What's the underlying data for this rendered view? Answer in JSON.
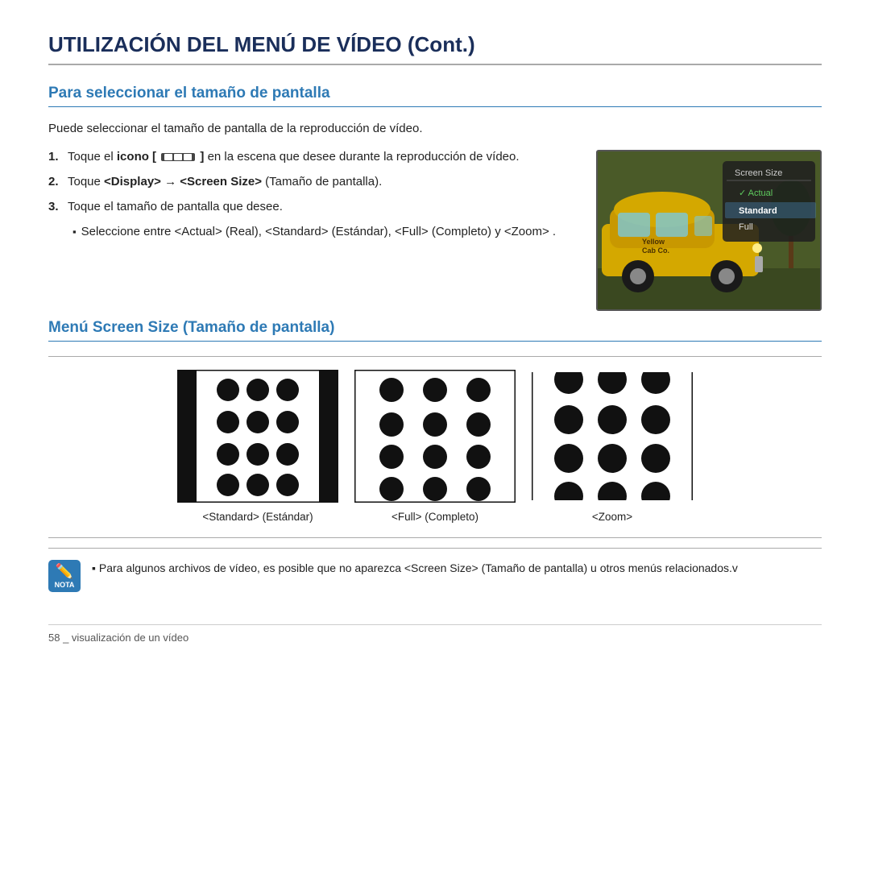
{
  "page": {
    "main_title": "UTILIZACIÓN DEL MENÚ DE VÍDEO (Cont.)",
    "section1_title": "Para seleccionar el tamaño de pantalla",
    "intro": "Puede seleccionar el tamaño de pantalla de la reproducción de vídeo.",
    "steps": [
      {
        "num": "1.",
        "text_before": "Toque el ",
        "bold": "icono [",
        "text_icon": "icon",
        "text_after": "] en la escena que desee durante la reproducción de vídeo."
      },
      {
        "num": "2.",
        "bold": "Toque <Display> → <Screen Size>",
        "text_after": " (Tamaño de pantalla)."
      },
      {
        "num": "3.",
        "text": "Toque el tamaño de pantalla que desee."
      }
    ],
    "bullet": "Seleccione entre <Actual> (Real), <Standard> (Estándar), <Full> (Completo) y <Zoom> .",
    "video_menu": {
      "title": "Screen Size",
      "items": [
        {
          "label": "Actual",
          "state": "checkmark"
        },
        {
          "label": "Standard",
          "state": "selected"
        },
        {
          "label": "Full",
          "state": "normal"
        }
      ]
    },
    "section2_title": "Menú Screen Size (Tamaño de pantalla)",
    "diagrams": [
      {
        "type": "standard",
        "label": "<Standard> (Estándar)"
      },
      {
        "type": "full",
        "label": "<Full> (Completo)"
      },
      {
        "type": "zoom",
        "label": "<Zoom>"
      }
    ],
    "note": "Para algunos archivos de vídeo, es posible que no aparezca <Screen Size> (Tamaño de pantalla) u otros menús relacionados.v",
    "nota_label": "NOTA",
    "footer": "58 _ visualización de un vídeo"
  }
}
